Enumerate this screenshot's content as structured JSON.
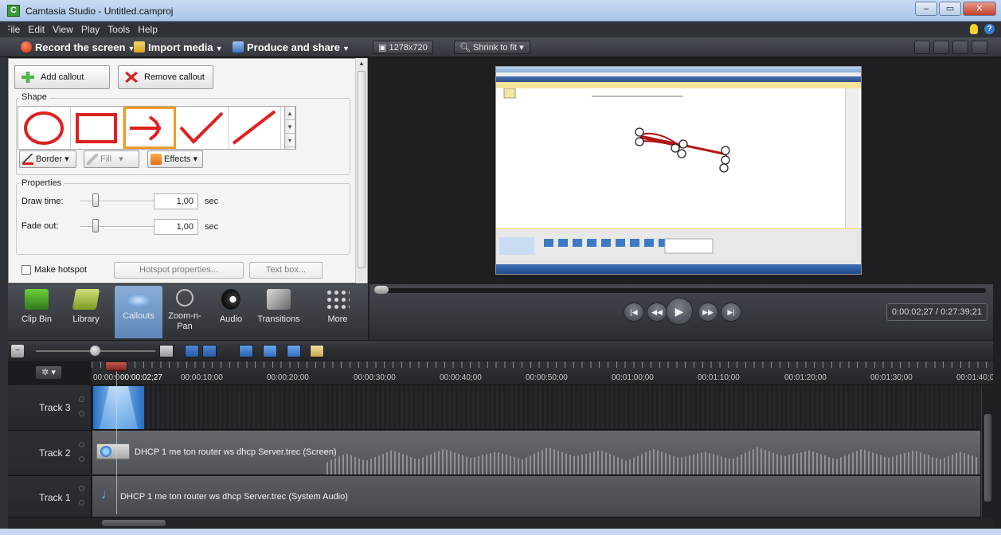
{
  "window": {
    "title": "Camtasia Studio - Untitled.camproj",
    "app_letter": "C",
    "buttons": [
      "–",
      "▭",
      "✕"
    ]
  },
  "menu": [
    "File",
    "Edit",
    "View",
    "Play",
    "Tools",
    "Help"
  ],
  "toolbar": {
    "record": "Record the screen",
    "import": "Import media",
    "produce": "Produce and share",
    "resolution": "1278x720",
    "zoom": "Shrink to fit"
  },
  "callout_panel": {
    "add_callout": "Add callout",
    "remove_callout": "Remove callout",
    "shape_group": "Shape",
    "border": "Border",
    "fill": "Fill",
    "effects": "Effects",
    "properties_group": "Properties",
    "draw_time_label": "Draw time:",
    "draw_time_value": "1,00",
    "fade_out_label": "Fade out:",
    "fade_out_value": "1,00",
    "unit": "sec",
    "make_hotspot": "Make hotspot",
    "hotspot_properties": "Hotspot properties...",
    "text_box": "Text box..."
  },
  "tasks": [
    {
      "label": "Clip Bin",
      "icon": "clip-bin-icon"
    },
    {
      "label": "Library",
      "icon": "library-icon"
    },
    {
      "label": "Callouts",
      "icon": "callouts-icon"
    },
    {
      "label": "Zoom-n-Pan",
      "icon": "zoom-icon"
    },
    {
      "label": "Audio",
      "icon": "audio-icon"
    },
    {
      "label": "Transitions",
      "icon": "transitions-icon"
    },
    {
      "label": "More",
      "icon": "more-icon"
    }
  ],
  "player": {
    "timecode": "0:00:02;27 / 0:27:39;21",
    "buttons": [
      "previous-clip",
      "rewind",
      "play",
      "fast-forward",
      "next-clip"
    ]
  },
  "timeline": {
    "ruler": [
      "00:00:0",
      "00:00:02;27",
      "00:00:10;00",
      "00:00:20;00",
      "00:00:30;00",
      "00:00:40;00",
      "00:00:50;00",
      "00:01:00;00",
      "00:01:10;00",
      "00:01:20;00",
      "00:01:30;00",
      "00:01:40;0"
    ],
    "tracks": [
      {
        "name": "Track 3",
        "clip": ""
      },
      {
        "name": "Track 2",
        "clip": "DHCP 1 me ton router ws dhcp Server.trec (Screen)"
      },
      {
        "name": "Track 1",
        "clip": "DHCP 1 me ton router ws dhcp Server.trec (System Audio)"
      }
    ]
  },
  "colors": {
    "accent_orange": "#f39a26",
    "callout_red": "#e02020",
    "dark_bg": "#1e2024"
  }
}
